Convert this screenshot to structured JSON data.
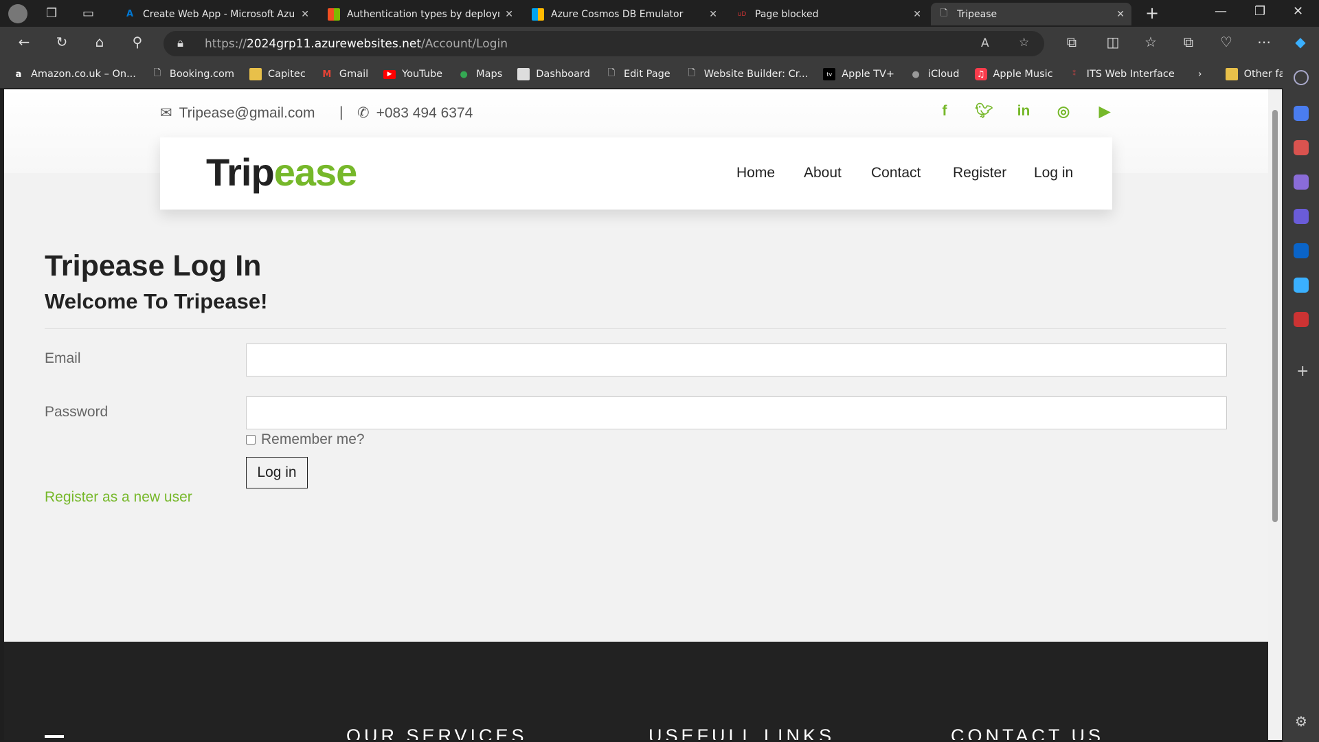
{
  "browser": {
    "tabs": [
      {
        "label": "Create Web App - Microsoft Azure",
        "icon": "azure-icon",
        "color": "#0078d4"
      },
      {
        "label": "Authentication types by deployment",
        "icon": "microsoft-icon",
        "color": "#f25022"
      },
      {
        "label": "Azure Cosmos DB Emulator",
        "icon": "microsoft-icon",
        "color": "#f25022"
      },
      {
        "label": "Page blocked",
        "icon": "ublock-icon",
        "color": "#800000"
      },
      {
        "label": "Tripease",
        "icon": "page-icon",
        "color": "#cccccc"
      }
    ],
    "url_prefix": "https://",
    "url_host": "2024grp11.azurewebsites.net",
    "url_path": "/Account/Login",
    "bookmarks": [
      {
        "label": "Amazon.co.uk – On...",
        "icon": "amazon-icon"
      },
      {
        "label": "Booking.com",
        "icon": "page-icon"
      },
      {
        "label": "Capitec",
        "icon": "folder-icon"
      },
      {
        "label": "Gmail",
        "icon": "gmail-icon"
      },
      {
        "label": "YouTube",
        "icon": "youtube-icon"
      },
      {
        "label": "Maps",
        "icon": "maps-icon"
      },
      {
        "label": "Dashboard",
        "icon": "dashboard-icon"
      },
      {
        "label": "Edit Page",
        "icon": "page-icon"
      },
      {
        "label": "Website Builder: Cr...",
        "icon": "page-icon"
      },
      {
        "label": "Apple TV+",
        "icon": "appletv-icon"
      },
      {
        "label": "iCloud",
        "icon": "apple-icon"
      },
      {
        "label": "Apple Music",
        "icon": "music-icon"
      },
      {
        "label": "ITS Web Interface",
        "icon": "its-icon"
      }
    ],
    "other_favorites": "Other favorites"
  },
  "site": {
    "email": "Tripease@gmail.com",
    "separator": "|",
    "phone": "+083 494 6374",
    "social": [
      "facebook-icon",
      "twitter-icon",
      "linkedin-icon",
      "instagram-icon",
      "youtube-icon"
    ],
    "logo_dark": "Trip",
    "logo_green": "ease",
    "nav": [
      "Home",
      "About",
      "Contact",
      "Register",
      "Log in"
    ],
    "accent": "#76b82a"
  },
  "login": {
    "title": "Tripease Log In",
    "subtitle": "Welcome To Tripease!",
    "email_label": "Email",
    "email_value": "",
    "password_label": "Password",
    "password_value": "",
    "remember_label": "Remember me?",
    "remember_checked": false,
    "submit": "Log in",
    "register_link": "Register as a new user"
  },
  "footer": {
    "headings": [
      "OUR SERVICES",
      "USEFULL LINKS",
      "CONTACT US"
    ]
  }
}
